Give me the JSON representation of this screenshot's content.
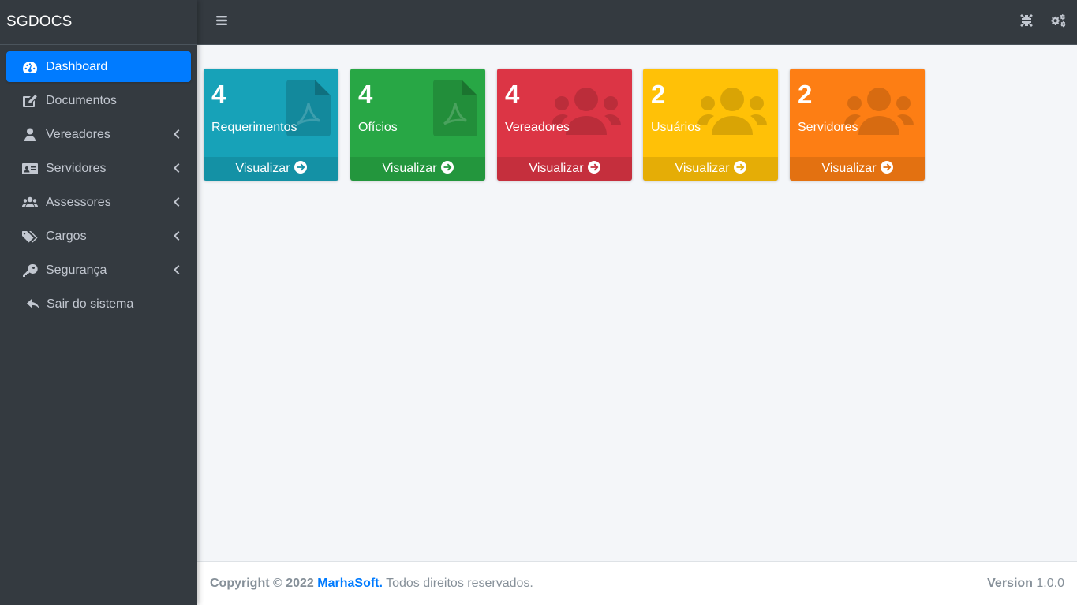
{
  "brand": "SGDOCS",
  "sidebar": {
    "items": [
      {
        "label": "Dashboard",
        "icon": "tachometer-icon",
        "active": true
      },
      {
        "label": "Documentos",
        "icon": "edit-icon"
      },
      {
        "label": "Vereadores",
        "icon": "user-icon",
        "chevron": true
      },
      {
        "label": "Servidores",
        "icon": "id-card-icon",
        "chevron": true
      },
      {
        "label": "Assessores",
        "icon": "users-icon",
        "chevron": true
      },
      {
        "label": "Cargos",
        "icon": "tags-icon",
        "chevron": true
      },
      {
        "label": "Segurança",
        "icon": "key-icon",
        "chevron": true
      },
      {
        "label": "Sair do sistema",
        "icon": "reply-icon"
      }
    ]
  },
  "header": {
    "menu_icon": "bars-icon",
    "fullscreen_icon": "compress-icon",
    "settings_icon": "cogs-icon"
  },
  "boxes": [
    {
      "count": "4",
      "label": "Requerimentos",
      "link": "Visualizar",
      "color": "#17a2b8",
      "icon": "file-pdf-icon"
    },
    {
      "count": "4",
      "label": "Ofícios",
      "link": "Visualizar",
      "color": "#28a745",
      "icon": "file-pdf-icon"
    },
    {
      "count": "4",
      "label": "Vereadores",
      "link": "Visualizar",
      "color": "#dc3545",
      "icon": "users-icon"
    },
    {
      "count": "2",
      "label": "Usuários",
      "link": "Visualizar",
      "color": "#ffc107",
      "icon": "users-icon"
    },
    {
      "count": "2",
      "label": "Servidores",
      "link": "Visualizar",
      "color": "#fd7e14",
      "icon": "users-icon"
    }
  ],
  "footer": {
    "copyright": "Copyright © 2022",
    "company": "MarhaSoft.",
    "rights": "Todos direitos reservados.",
    "version_label": "Version",
    "version": "1.0.0"
  },
  "colors": {
    "accent": "#007bff",
    "sidebar_bg": "#343a40"
  }
}
